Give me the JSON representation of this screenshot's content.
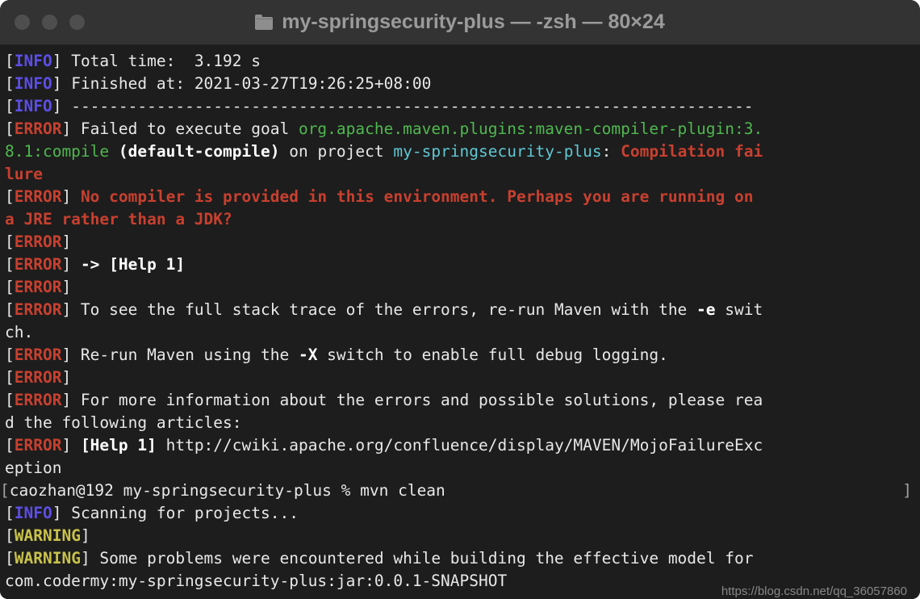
{
  "window": {
    "title": "my-springsecurity-plus — -zsh — 80×24",
    "folder_icon": "folder-icon",
    "traffic_lights": [
      "close-button",
      "minimize-button",
      "zoom-button"
    ],
    "background_color": "#1d1d1d",
    "titlebar_color": "#333333"
  },
  "palette": {
    "foreground": "#e8e8e8",
    "info": "#5c4ee5",
    "error": "#c8402f",
    "warning": "#c9c24a",
    "green": "#4fb84f",
    "cyan": "#5fc8d4",
    "bold_white": "#ffffff"
  },
  "terminal": {
    "columns": 80,
    "rows": 24,
    "shell": "-zsh",
    "lines": [
      [
        {
          "t": "[",
          "c": "white"
        },
        {
          "t": "INFO",
          "c": "info"
        },
        {
          "t": "] Total time:  3.192 s",
          "c": "white"
        }
      ],
      [
        {
          "t": "[",
          "c": "white"
        },
        {
          "t": "INFO",
          "c": "info"
        },
        {
          "t": "] Finished at: 2021-03-27T19:26:25+08:00",
          "c": "white"
        }
      ],
      [
        {
          "t": "[",
          "c": "white"
        },
        {
          "t": "INFO",
          "c": "info"
        },
        {
          "t": "] ------------------------------------------------------------------------",
          "c": "white"
        }
      ],
      [
        {
          "t": "[",
          "c": "white"
        },
        {
          "t": "ERROR",
          "c": "error"
        },
        {
          "t": "] Failed to execute goal ",
          "c": "white"
        },
        {
          "t": "org.apache.maven.plugins:maven-compiler-plugin:3.",
          "c": "green"
        }
      ],
      [
        {
          "t": "8.1:compile",
          "c": "green"
        },
        {
          "t": " ",
          "c": "white"
        },
        {
          "t": "(default-compile)",
          "c": "bwhite"
        },
        {
          "t": " on project ",
          "c": "white"
        },
        {
          "t": "my-springsecurity-plus",
          "c": "cyan"
        },
        {
          "t": ": ",
          "c": "white"
        },
        {
          "t": "Compilation fai",
          "c": "red"
        }
      ],
      [
        {
          "t": "lure",
          "c": "red"
        }
      ],
      [
        {
          "t": "[",
          "c": "white"
        },
        {
          "t": "ERROR",
          "c": "error"
        },
        {
          "t": "] ",
          "c": "white"
        },
        {
          "t": "No compiler is provided in this environment. Perhaps you are running on",
          "c": "red"
        }
      ],
      [
        {
          "t": "a JRE rather than a JDK?",
          "c": "red"
        }
      ],
      [
        {
          "t": "[",
          "c": "white"
        },
        {
          "t": "ERROR",
          "c": "error"
        },
        {
          "t": "]",
          "c": "white"
        }
      ],
      [
        {
          "t": "[",
          "c": "white"
        },
        {
          "t": "ERROR",
          "c": "error"
        },
        {
          "t": "] ",
          "c": "white"
        },
        {
          "t": "-> [Help 1]",
          "c": "bwhite"
        }
      ],
      [
        {
          "t": "[",
          "c": "white"
        },
        {
          "t": "ERROR",
          "c": "error"
        },
        {
          "t": "]",
          "c": "white"
        }
      ],
      [
        {
          "t": "[",
          "c": "white"
        },
        {
          "t": "ERROR",
          "c": "error"
        },
        {
          "t": "] To see the full stack trace of the errors, re-run Maven with the ",
          "c": "white"
        },
        {
          "t": "-e",
          "c": "bwhite"
        },
        {
          "t": " swit",
          "c": "white"
        }
      ],
      [
        {
          "t": "ch.",
          "c": "white"
        }
      ],
      [
        {
          "t": "[",
          "c": "white"
        },
        {
          "t": "ERROR",
          "c": "error"
        },
        {
          "t": "] Re-run Maven using the ",
          "c": "white"
        },
        {
          "t": "-X",
          "c": "bwhite"
        },
        {
          "t": " switch to enable full debug logging.",
          "c": "white"
        }
      ],
      [
        {
          "t": "[",
          "c": "white"
        },
        {
          "t": "ERROR",
          "c": "error"
        },
        {
          "t": "]",
          "c": "white"
        }
      ],
      [
        {
          "t": "[",
          "c": "white"
        },
        {
          "t": "ERROR",
          "c": "error"
        },
        {
          "t": "] For more information about the errors and possible solutions, please rea",
          "c": "white"
        }
      ],
      [
        {
          "t": "d the following articles:",
          "c": "white"
        }
      ],
      [
        {
          "t": "[",
          "c": "white"
        },
        {
          "t": "ERROR",
          "c": "error"
        },
        {
          "t": "] ",
          "c": "white"
        },
        {
          "t": "[Help 1]",
          "c": "bwhite"
        },
        {
          "t": " http://cwiki.apache.org/confluence/display/MAVEN/MojoFailureExc",
          "c": "white"
        }
      ],
      [
        {
          "t": "eption",
          "c": "white"
        }
      ],
      [
        {
          "t": "caozhan@192 my-springsecurity-plus % mvn clean",
          "c": "white"
        }
      ],
      [
        {
          "t": "[",
          "c": "white"
        },
        {
          "t": "INFO",
          "c": "info"
        },
        {
          "t": "] Scanning for projects...",
          "c": "white"
        }
      ],
      [
        {
          "t": "[",
          "c": "white"
        },
        {
          "t": "WARNING",
          "c": "warn"
        },
        {
          "t": "]",
          "c": "white"
        }
      ],
      [
        {
          "t": "[",
          "c": "white"
        },
        {
          "t": "WARNING",
          "c": "warn"
        },
        {
          "t": "] Some problems were encountered while building the effective model for",
          "c": "white"
        }
      ],
      [
        {
          "t": "com.codermy:my-springsecurity-plus:jar:0.0.1-SNAPSHOT",
          "c": "white"
        }
      ]
    ],
    "prompt_line_index": 19,
    "prompt_bracket_left": "[",
    "prompt_bracket_right": "]"
  },
  "watermark": {
    "text": "https://blog.csdn.net/qq_36057860"
  }
}
